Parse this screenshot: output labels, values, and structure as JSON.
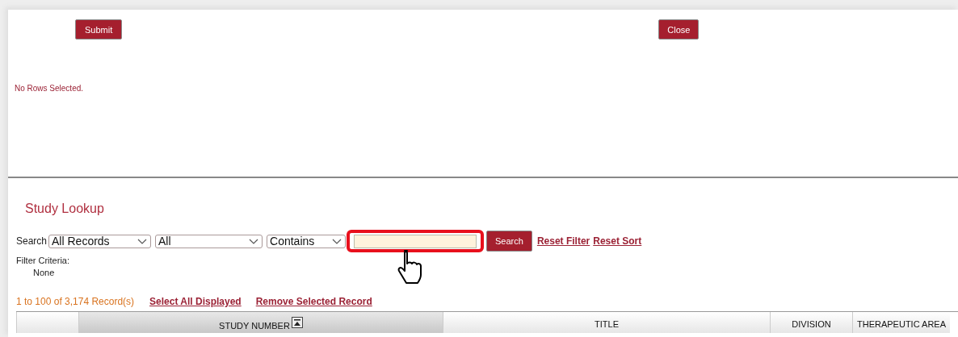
{
  "top_panel": {
    "buttons": [
      {
        "label": "Submit"
      },
      {
        "label": "Close"
      }
    ],
    "message": "No Rows Selected."
  },
  "lookup": {
    "title": "Study Lookup",
    "search": {
      "label": "Search",
      "dropdowns": [
        {
          "value": "All Records"
        },
        {
          "value": "All"
        },
        {
          "value": "Contains"
        }
      ],
      "field": {
        "highlighted": true
      },
      "button": "Search",
      "links": [
        "Reset Filter",
        "Reset Sort"
      ]
    },
    "filter": {
      "label": "Filter Criteria:",
      "value": "None"
    },
    "records": {
      "count": "1 to 100 of 3,174 Record(s)",
      "links": [
        "Select All Displayed",
        "Remove Selected Record"
      ]
    },
    "table": {
      "columns": [
        {
          "sorted": false
        },
        {
          "label": "STUDY NUMBER",
          "sorted": true
        },
        {
          "label": "TITLE",
          "sorted": false
        },
        {
          "label": "DIVISION",
          "sorted": false
        },
        {
          "label": "THERAPEUTIC AREA",
          "sorted": false
        }
      ]
    }
  }
}
